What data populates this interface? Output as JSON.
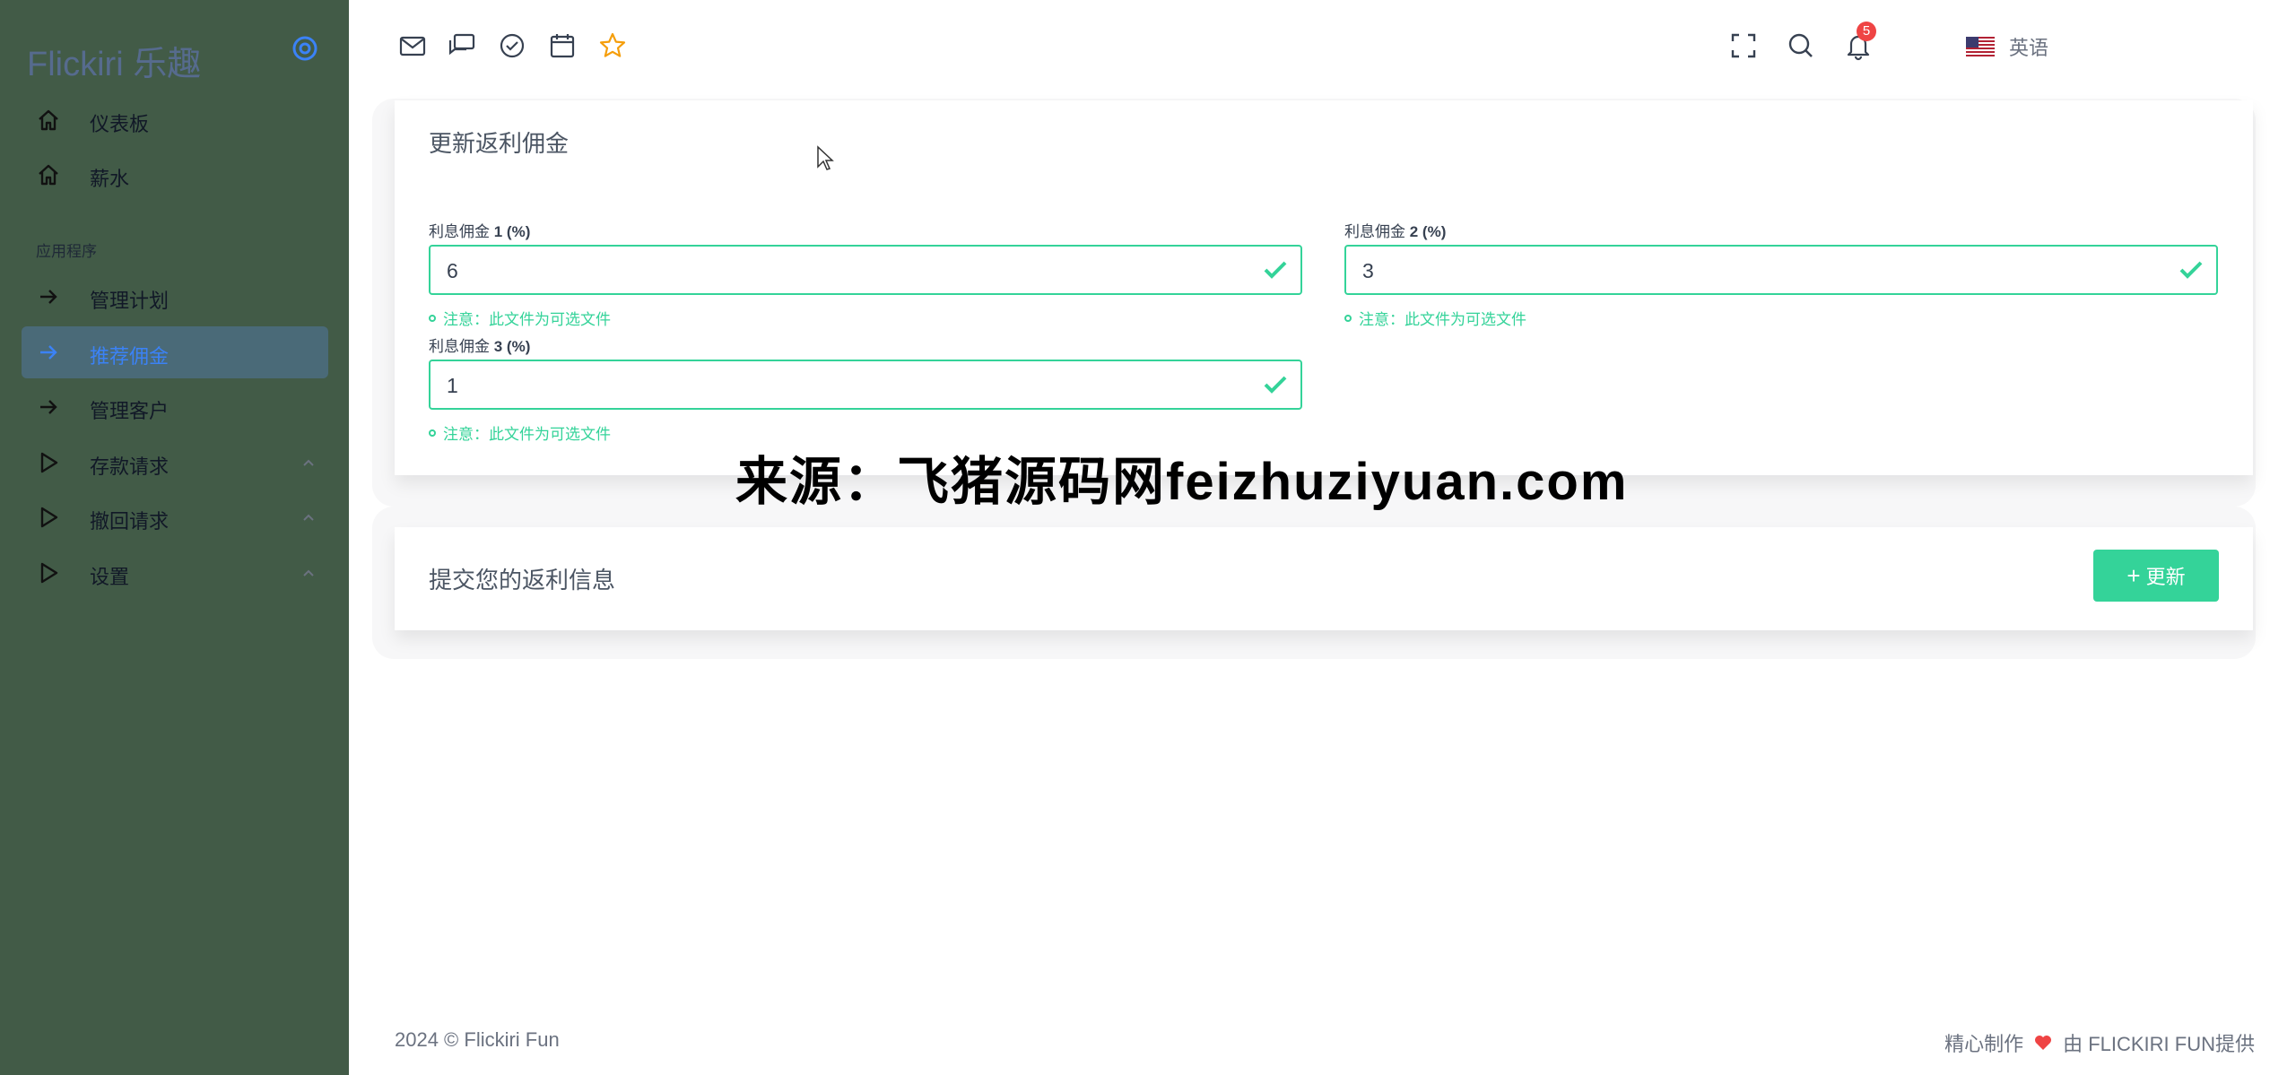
{
  "sidebar": {
    "brand": "Flickiri 乐趣",
    "section_label": "应用程序",
    "items": [
      {
        "label": "仪表板",
        "icon": "home-icon"
      },
      {
        "label": "薪水",
        "icon": "home-icon"
      },
      {
        "label": "管理计划",
        "icon": "arrow-right-icon"
      },
      {
        "label": "推荐佣金",
        "icon": "arrow-right-icon",
        "active": true
      },
      {
        "label": "管理客户",
        "icon": "arrow-right-icon"
      },
      {
        "label": "存款请求",
        "icon": "play-icon",
        "expandable": true
      },
      {
        "label": "撤回请求",
        "icon": "play-icon",
        "expandable": true
      },
      {
        "label": "设置",
        "icon": "play-icon",
        "expandable": true
      }
    ]
  },
  "topbar": {
    "language": "英语",
    "notification_count": "5",
    "icons": [
      "mail-icon",
      "chat-icon",
      "check-circle-icon",
      "calendar-icon",
      "star-icon",
      "flag-us-icon",
      "fullscreen-icon",
      "search-icon",
      "bell-icon"
    ]
  },
  "form_card": {
    "title": "更新返利佣金",
    "fields": [
      {
        "label_prefix": "利息佣金 ",
        "label_bold": "1 (%)",
        "value": "6",
        "note": "注意：此文件为可选文件"
      },
      {
        "label_prefix": "利息佣金 ",
        "label_bold": "2 (%)",
        "value": "3",
        "note": "注意：此文件为可选文件"
      },
      {
        "label_prefix": "利息佣金 ",
        "label_bold": "3 (%)",
        "value": "1",
        "note": "注意：此文件为可选文件"
      }
    ]
  },
  "submit_card": {
    "title": "提交您的返利信息",
    "button_plus": "+",
    "button_label": "更新"
  },
  "watermark": "来源：飞猪源码网feizhuziyuan.com",
  "footer": {
    "left": "2024 © Flickiri Fun",
    "right_prefix": "精心制作",
    "right_suffix": "由 FLICKIRI FUN提供"
  },
  "colors": {
    "sidebar_bg": "#425b47",
    "accent": "#34d399",
    "active_text": "#3b82f6",
    "badge": "#ef4444"
  }
}
